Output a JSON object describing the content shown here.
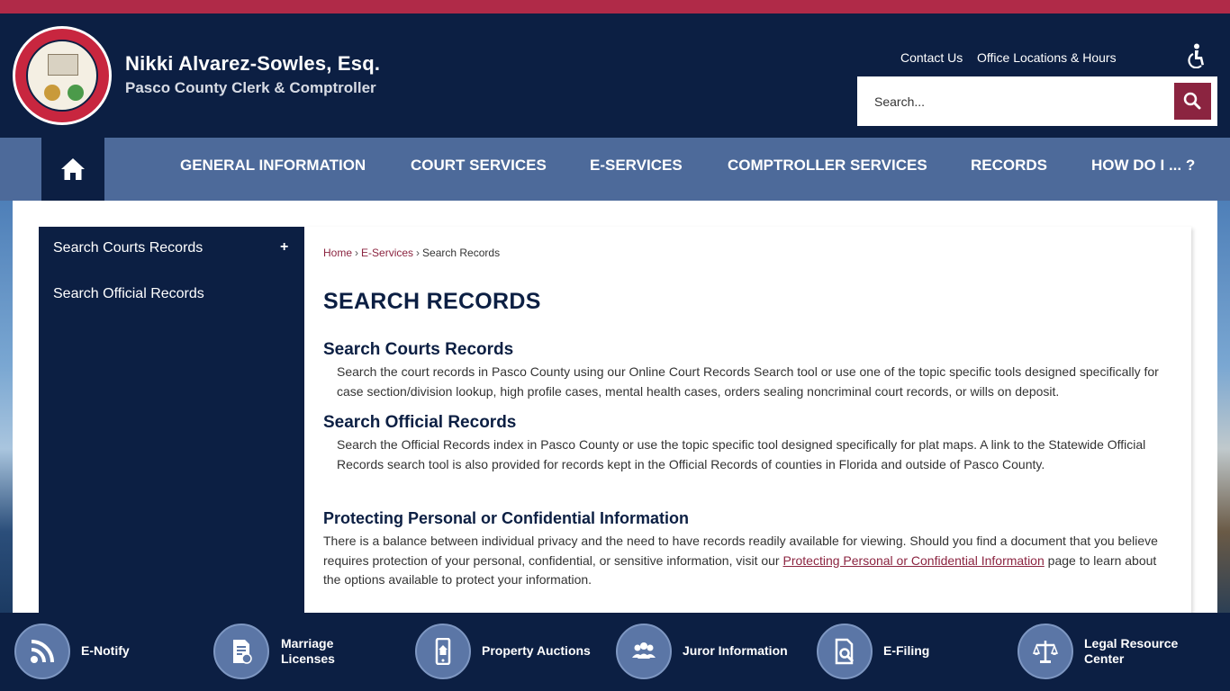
{
  "header": {
    "org_name": "Nikki Alvarez-Sowles, Esq.",
    "org_subtitle": "Pasco County Clerk & Comptroller",
    "utility_links": [
      "Contact Us",
      "Office Locations & Hours"
    ],
    "search_placeholder": "Search..."
  },
  "nav": {
    "items": [
      "GENERAL INFORMATION",
      "COURT SERVICES",
      "E-SERVICES",
      "COMPTROLLER SERVICES",
      "RECORDS",
      "HOW DO I ... ?"
    ]
  },
  "sidebar": {
    "items": [
      "Search Courts Records",
      "Search Official Records"
    ],
    "expand_symbol": "+"
  },
  "breadcrumb": {
    "home": "Home",
    "eservices": "E-Services",
    "current": "Search Records",
    "separator": "›"
  },
  "content": {
    "title": "SEARCH RECORDS",
    "sections": [
      {
        "heading": "Search Courts Records",
        "text": "Search the court records in Pasco County using our Online Court Records Search tool or use one of the topic specific tools designed specifically for case section/division lookup, high profile cases, mental health cases, orders sealing noncriminal court records, or wills on deposit."
      },
      {
        "heading": "Search Official Records",
        "text": "Search the Official Records index in Pasco County or use the topic specific tool designed specifically for plat maps. A link to the Statewide Official Records search tool is also provided for records kept in the Official Records of counties in Florida and outside of Pasco County."
      }
    ],
    "privacy": {
      "heading": "Protecting Personal or Confidential Information",
      "text_before": "There is a balance between individual privacy and the need to have records readily available for viewing. Should you find a document that you believe requires protection of your personal, confidential, or sensitive information, visit our ",
      "link": "Protecting Personal or Confidential Information",
      "text_after": " page to learn about the options available to protect your information."
    }
  },
  "footer": {
    "quick_links": [
      {
        "label": "E-Notify",
        "icon": "rss-icon"
      },
      {
        "label": "Marriage Licenses",
        "icon": "certificate-icon"
      },
      {
        "label": "Property Auctions",
        "icon": "mobile-house-icon"
      },
      {
        "label": "Juror Information",
        "icon": "people-icon"
      },
      {
        "label": "E-Filing",
        "icon": "document-search-icon"
      },
      {
        "label": "Legal Resource Center",
        "icon": "scales-icon"
      }
    ]
  },
  "colors": {
    "navy": "#0c1f43",
    "nav_blue": "#4d6a9a",
    "accent_red": "#b02a48",
    "link_maroon": "#8b2440"
  }
}
